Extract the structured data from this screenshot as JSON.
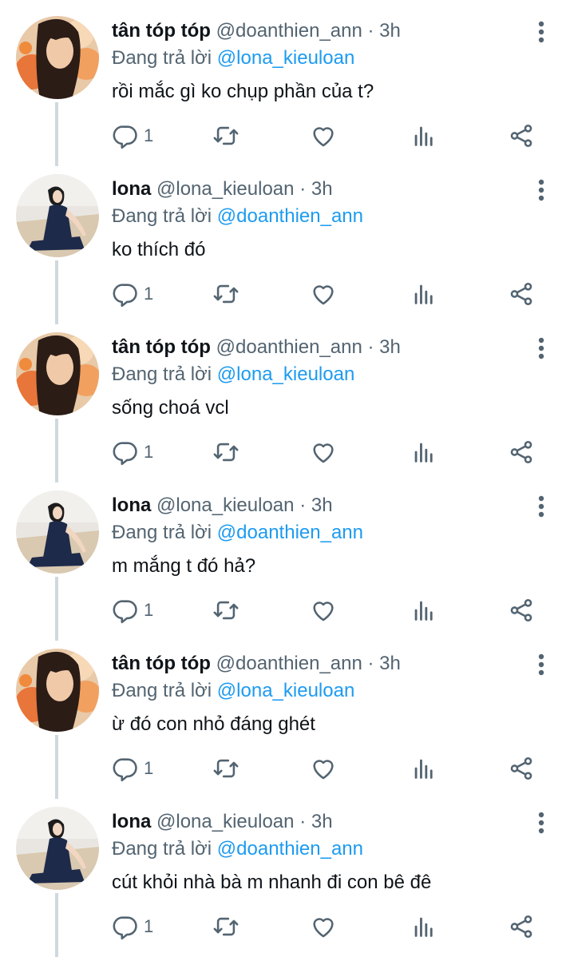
{
  "users": {
    "tan": {
      "name": "tân tóp tóp",
      "handle": "@doanthien_ann"
    },
    "lona": {
      "name": "lona",
      "handle": "@lona_kieuloan"
    }
  },
  "dot": "·",
  "replying_prefix": "Đang trả lời",
  "tweets": [
    {
      "name": "tân tóp tóp",
      "handle": "@doanthien_ann",
      "time": "3h",
      "replying_to": "@lona_kieuloan",
      "text": "rồi mắc gì ko chụp phần của t?",
      "reply_count": "1",
      "avatar": "tan"
    },
    {
      "name": "lona",
      "handle": "@lona_kieuloan",
      "time": "3h",
      "replying_to": "@doanthien_ann",
      "text": "ko thích đó",
      "reply_count": "1",
      "avatar": "lona"
    },
    {
      "name": "tân tóp tóp",
      "handle": "@doanthien_ann",
      "time": "3h",
      "replying_to": "@lona_kieuloan",
      "text": "sống choá vcl",
      "reply_count": "1",
      "avatar": "tan"
    },
    {
      "name": "lona",
      "handle": "@lona_kieuloan",
      "time": "3h",
      "replying_to": "@doanthien_ann",
      "text": "m mắng t đó hả?",
      "reply_count": "1",
      "avatar": "lona"
    },
    {
      "name": "tân tóp tóp",
      "handle": "@doanthien_ann",
      "time": "3h",
      "replying_to": "@lona_kieuloan",
      "text": "ừ đó con nhỏ đáng ghét",
      "reply_count": "1",
      "avatar": "tan"
    },
    {
      "name": "lona",
      "handle": "@lona_kieuloan",
      "time": "3h",
      "replying_to": "@doanthien_ann",
      "text": "cút khỏi nhà bà m nhanh đi con bê đê",
      "reply_count": "1",
      "avatar": "lona"
    }
  ],
  "colors": {
    "text": "#0f1419",
    "secondary": "#536471",
    "mention": "#1d9bf0",
    "thread_line": "#cfd9de"
  },
  "icons": [
    "reply-icon",
    "retweet-icon",
    "like-icon",
    "views-icon",
    "share-icon",
    "more-icon"
  ]
}
